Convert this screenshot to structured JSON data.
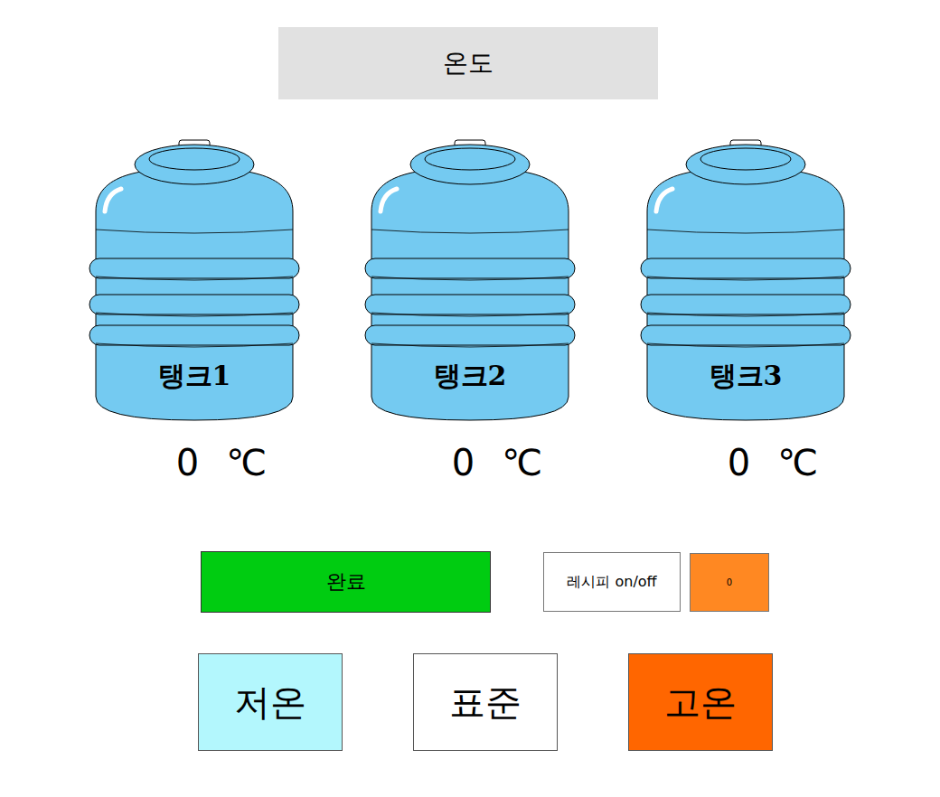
{
  "title": "온도",
  "tanks": [
    {
      "name": "탱크1",
      "temperature": "0",
      "unit": "℃"
    },
    {
      "name": "탱크2",
      "temperature": "0",
      "unit": "℃"
    },
    {
      "name": "탱크3",
      "temperature": "0",
      "unit": "℃"
    }
  ],
  "complete_button": "완료",
  "recipe": {
    "label": "레시피 on/off",
    "value": "0"
  },
  "modes": [
    {
      "label": "저온",
      "color": "#b3f7fd"
    },
    {
      "label": "표준",
      "color": "#ffffff"
    },
    {
      "label": "고온",
      "color": "#ff6600"
    }
  ]
}
